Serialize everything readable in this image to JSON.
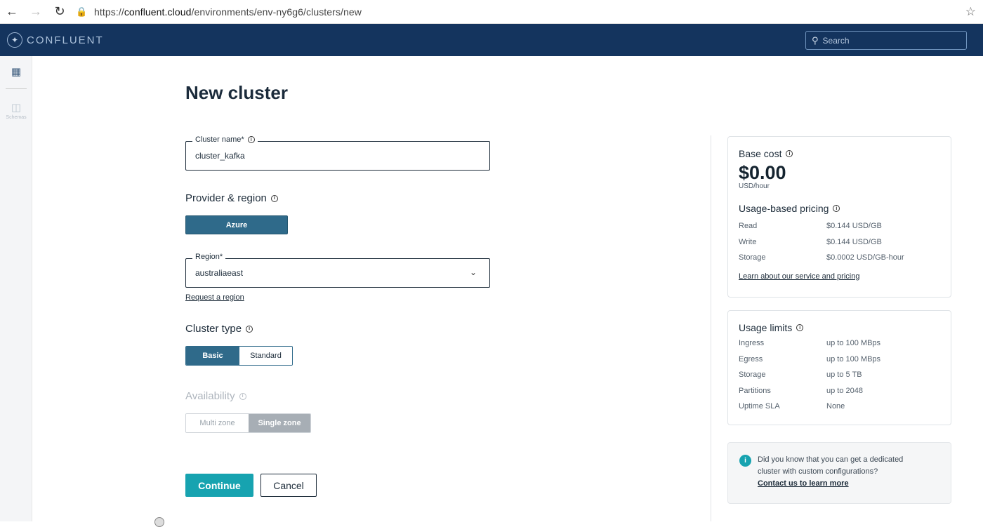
{
  "browser": {
    "url_prefix": "https://",
    "url_host": "confluent.cloud",
    "url_path": "/environments/env-ny6g6/clusters/new"
  },
  "header": {
    "logo_text": "CONFLUENT",
    "search_placeholder": "Search"
  },
  "rail": {
    "item2_label": "Schemas"
  },
  "page": {
    "title": "New cluster"
  },
  "cluster_name": {
    "label": "Cluster name*",
    "value": "cluster_kafka"
  },
  "provider": {
    "title": "Provider & region",
    "selected": "Azure"
  },
  "region": {
    "label": "Region*",
    "value": "australiaeast",
    "request_link": "Request a region"
  },
  "cluster_type": {
    "title": "Cluster type",
    "options": [
      "Basic",
      "Standard"
    ],
    "selected": "Basic"
  },
  "availability": {
    "title": "Availability",
    "options": [
      "Multi zone",
      "Single zone"
    ],
    "selected": "Single zone"
  },
  "actions": {
    "continue": "Continue",
    "cancel": "Cancel"
  },
  "base_cost": {
    "title": "Base cost",
    "amount": "$0.00",
    "unit": "USD/hour"
  },
  "usage_pricing": {
    "title": "Usage-based pricing",
    "rows": [
      {
        "k": "Read",
        "v": "$0.144 USD/GB"
      },
      {
        "k": "Write",
        "v": "$0.144 USD/GB"
      },
      {
        "k": "Storage",
        "v": "$0.0002 USD/GB-hour"
      }
    ],
    "link": "Learn about our service and pricing"
  },
  "usage_limits": {
    "title": "Usage limits",
    "rows": [
      {
        "k": "Ingress",
        "v": "up to 100 MBps"
      },
      {
        "k": "Egress",
        "v": "up to 100 MBps"
      },
      {
        "k": "Storage",
        "v": "up to 5 TB"
      },
      {
        "k": "Partitions",
        "v": "up to 2048"
      },
      {
        "k": "Uptime SLA",
        "v": "None"
      }
    ]
  },
  "dedicated_info": {
    "line1": "Did you know that you can get a dedicated",
    "line2": "cluster with custom configurations?",
    "link": "Contact us to learn more"
  },
  "colors": {
    "header_bg": "#14345e",
    "primary": "#2f6a8a",
    "accent": "#17a3b0"
  }
}
